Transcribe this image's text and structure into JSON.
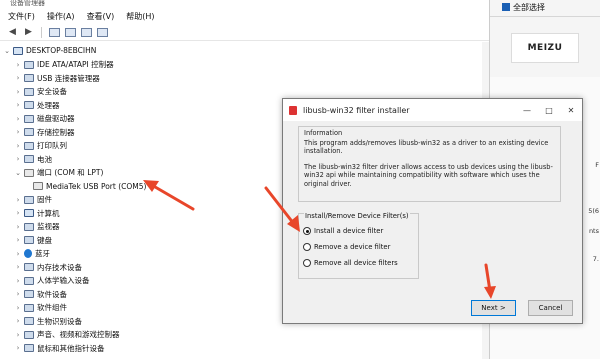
{
  "device_manager": {
    "title": "设备管理器",
    "menu": [
      "文件(F)",
      "操作(A)",
      "查看(V)",
      "帮助(H)"
    ],
    "tree": [
      {
        "label": "DESKTOP-8EBCIHN",
        "icon": "computer-icon"
      },
      {
        "label": "IDE ATA/ATAPI 控制器",
        "icon": "ide-controller-icon"
      },
      {
        "label": "USB 连接器管理器",
        "icon": "usb-connector-icon"
      },
      {
        "label": "安全设备",
        "icon": "security-device-icon"
      },
      {
        "label": "处理器",
        "icon": "processor-icon"
      },
      {
        "label": "磁盘驱动器",
        "icon": "disk-drive-icon"
      },
      {
        "label": "存储控制器",
        "icon": "storage-controller-icon"
      },
      {
        "label": "打印队列",
        "icon": "print-queue-icon"
      },
      {
        "label": "电池",
        "icon": "battery-icon"
      },
      {
        "label": "端口 (COM 和 LPT)",
        "icon": "port-icon"
      },
      {
        "label": "MediaTek USB Port (COM5)",
        "icon": "port-device-icon"
      },
      {
        "label": "固件",
        "icon": "firmware-icon"
      },
      {
        "label": "计算机",
        "icon": "computer-icon"
      },
      {
        "label": "监视器",
        "icon": "monitor-icon"
      },
      {
        "label": "键盘",
        "icon": "keyboard-icon"
      },
      {
        "label": "蓝牙",
        "icon": "bluetooth-icon"
      },
      {
        "label": "内存技术设备",
        "icon": "memory-device-icon"
      },
      {
        "label": "人体学输入设备",
        "icon": "hid-icon"
      },
      {
        "label": "软件设备",
        "icon": "software-device-icon"
      },
      {
        "label": "软件组件",
        "icon": "software-component-icon"
      },
      {
        "label": "生物识别设备",
        "icon": "biometric-icon"
      },
      {
        "label": "声音、视频和游戏控制器",
        "icon": "sound-icon"
      },
      {
        "label": "鼠标和其他指针设备",
        "icon": "mouse-icon"
      }
    ]
  },
  "background_app": {
    "select_all": "全部选择",
    "brand": "MEIZU",
    "fragments": [
      "F",
      "5(6",
      "nts",
      "7."
    ]
  },
  "dialog": {
    "title": "libusb-win32 filter installer",
    "info_label": "Information",
    "info_p1": "This program adds/removes libusb-win32 as a driver to an existing device installation.",
    "info_p2": "The libusb-win32 filter driver allows access to usb devices using the libusb-win32 api while maintaining compatibility with software which uses the original driver.",
    "group_label": "Install/Remove Device Filter(s)",
    "options": [
      "Install a device filter",
      "Remove a device filter",
      "Remove all device filters"
    ],
    "selected_option": 0,
    "next_label": "Next >",
    "cancel_label": "Cancel"
  },
  "annotation_color": "#e8462a"
}
